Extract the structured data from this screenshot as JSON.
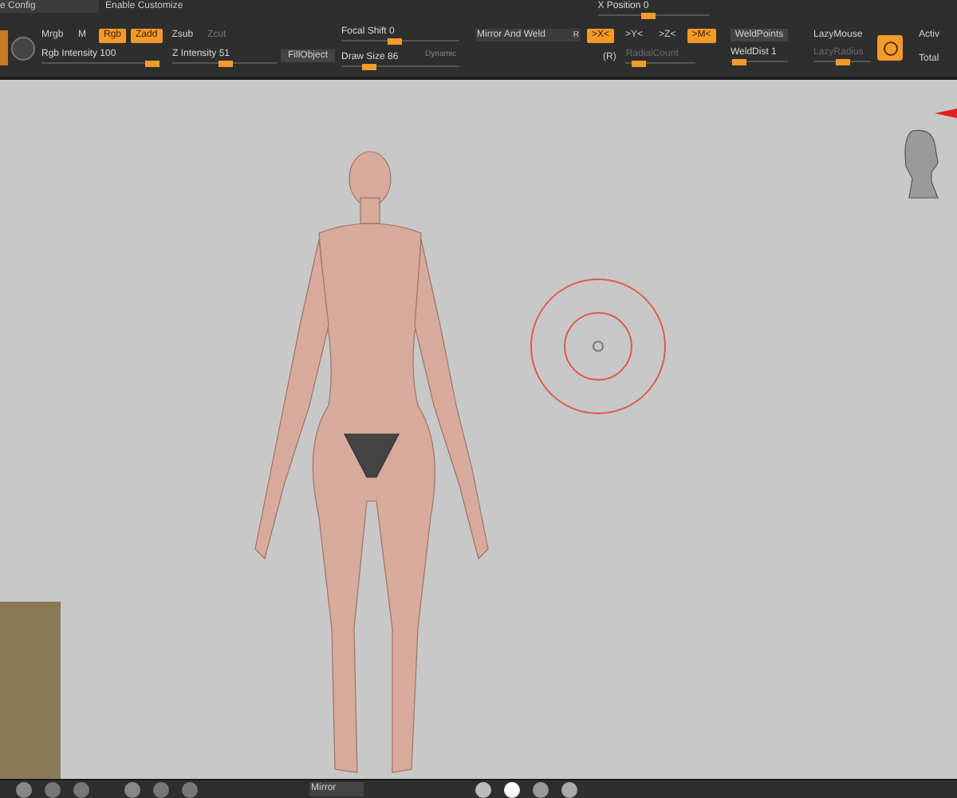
{
  "top_strip": {
    "config_field": "e Config",
    "customize": "Enable Customize",
    "x_position": {
      "label": "X Position 0",
      "level": 0.45
    }
  },
  "toolbar": {
    "mrgb": "Mrgb",
    "m": "M",
    "modes": [
      {
        "label": "Rgb",
        "selected": true,
        "disabled": false
      },
      {
        "label": "Zadd",
        "selected": true,
        "disabled": false
      },
      {
        "label": "Zsub",
        "selected": false,
        "disabled": false
      },
      {
        "label": "Zcut",
        "selected": false,
        "disabled": true
      }
    ],
    "rgb_intensity": {
      "label": "Rgb Intensity 100",
      "level": 1.0
    },
    "z_intensity": {
      "label": "Z Intensity 51",
      "level": 0.5
    },
    "fill_object": "FillObject",
    "focal_shift": {
      "label": "Focal Shift 0",
      "level": 0.45
    },
    "draw_size": {
      "label": "Draw Size 86",
      "level": 0.2
    },
    "dynamic": "Dynamic",
    "mirror_weld": "Mirror And Weld",
    "mirror_r": "R",
    "axes": [
      {
        "label": ">X<",
        "selected": true
      },
      {
        "label": ">Y<",
        "selected": false
      },
      {
        "label": ">Z<",
        "selected": false
      },
      {
        "label": ">M<",
        "selected": true
      }
    ],
    "radial_r": "(R)",
    "radial_count": {
      "label": "RadialCount",
      "level": 0.1
    },
    "weld_points": "WeldPoints",
    "weld_dist": {
      "label": "WeldDist 1",
      "level": 0.05
    },
    "lazy_mouse": "LazyMouse",
    "lazy_radius": {
      "label": "LazyRadius",
      "level": 0.5
    },
    "active": "Activ",
    "total": "Total"
  },
  "bottom_bar": {
    "mirror": "Mirror"
  }
}
